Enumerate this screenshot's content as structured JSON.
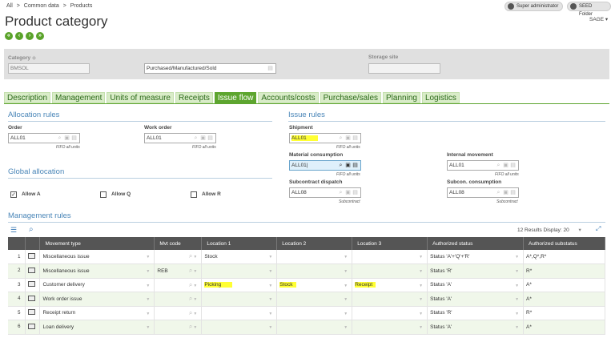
{
  "breadcrumb": {
    "root": "All",
    "sep": ">",
    "level1": "Common data",
    "level2": "Products"
  },
  "page_title": "Product category",
  "top_buttons": {
    "user": "Super administrator",
    "folder": "SEED Folder"
  },
  "company": "SAGE",
  "header": {
    "category_label": "Category",
    "category_value": "BMSOL",
    "desc_value": "Purchased/Manufactured/Sold",
    "storage_label": "Storage site",
    "storage_value": ""
  },
  "tabs": [
    "Description",
    "Management",
    "Units of measure",
    "Receipts",
    "Issue flow",
    "Accounts/costs",
    "Purchase/sales",
    "Planning",
    "Logistics"
  ],
  "active_tab": "Issue flow",
  "allocation": {
    "title": "Allocation rules",
    "order_label": "Order",
    "order_value": "ALL01",
    "order_sub": "FIFO all units",
    "wo_label": "Work order",
    "wo_value": "ALL01",
    "wo_sub": "FIFO all units"
  },
  "global": {
    "title": "Global allocation",
    "allow_a": "Allow A",
    "allow_q": "Allow Q",
    "allow_r": "Allow R"
  },
  "issue": {
    "title": "Issue rules",
    "shipment_label": "Shipment",
    "shipment_value": "ALL01",
    "shipment_sub": "FIFO all units",
    "matcons_label": "Material consumption",
    "matcons_value": "ALL01",
    "matcons_sub": "FIFO all units",
    "internal_label": "Internal movement",
    "internal_value": "ALL01",
    "internal_sub": "FIFO all units",
    "subdisp_label": "Subcontract dispatch",
    "subdisp_value": "ALL08",
    "subdisp_sub": "Subcontract",
    "subcons_label": "Subcon. consumption",
    "subcons_value": "ALL08",
    "subcons_sub": "Subcontract"
  },
  "mgmt": {
    "title": "Management rules",
    "results": "12 Results",
    "display_label": "Display:",
    "display_value": "20"
  },
  "columns": [
    "Movement type",
    "Mvt code",
    "Location 1",
    "Location 2",
    "Location 3",
    "Authorized status",
    "Authorized substatus"
  ],
  "rows": [
    {
      "num": "1",
      "movement": "Miscellaneous issue",
      "code": "",
      "loc1": "Stock",
      "loc2": "",
      "loc3": "",
      "status": "Status 'A'+'Q'+'R'",
      "substatus": "A*,Q*,R*"
    },
    {
      "num": "2",
      "movement": "Miscellaneous issue",
      "code": "REB",
      "loc1": "",
      "loc2": "",
      "loc3": "",
      "status": "Status 'R'",
      "substatus": "R*"
    },
    {
      "num": "3",
      "movement": "Customer delivery",
      "code": "",
      "loc1": "Picking",
      "loc2": "Stock",
      "loc3": "Receipt",
      "status": "Status 'A'",
      "substatus": "A*"
    },
    {
      "num": "4",
      "movement": "Work order issue",
      "code": "",
      "loc1": "",
      "loc2": "",
      "loc3": "",
      "status": "Status 'A'",
      "substatus": "A*"
    },
    {
      "num": "5",
      "movement": "Receipt return",
      "code": "",
      "loc1": "",
      "loc2": "",
      "loc3": "",
      "status": "Status 'R'",
      "substatus": "R*"
    },
    {
      "num": "6",
      "movement": "Loan delivery",
      "code": "",
      "loc1": "",
      "loc2": "",
      "loc3": "",
      "status": "Status 'A'",
      "substatus": "A*"
    }
  ],
  "colors": {
    "accent": "#5da52f",
    "tab_bg": "#d9ecc8",
    "section": "#4a86b8",
    "highlight": "#ffff33"
  }
}
